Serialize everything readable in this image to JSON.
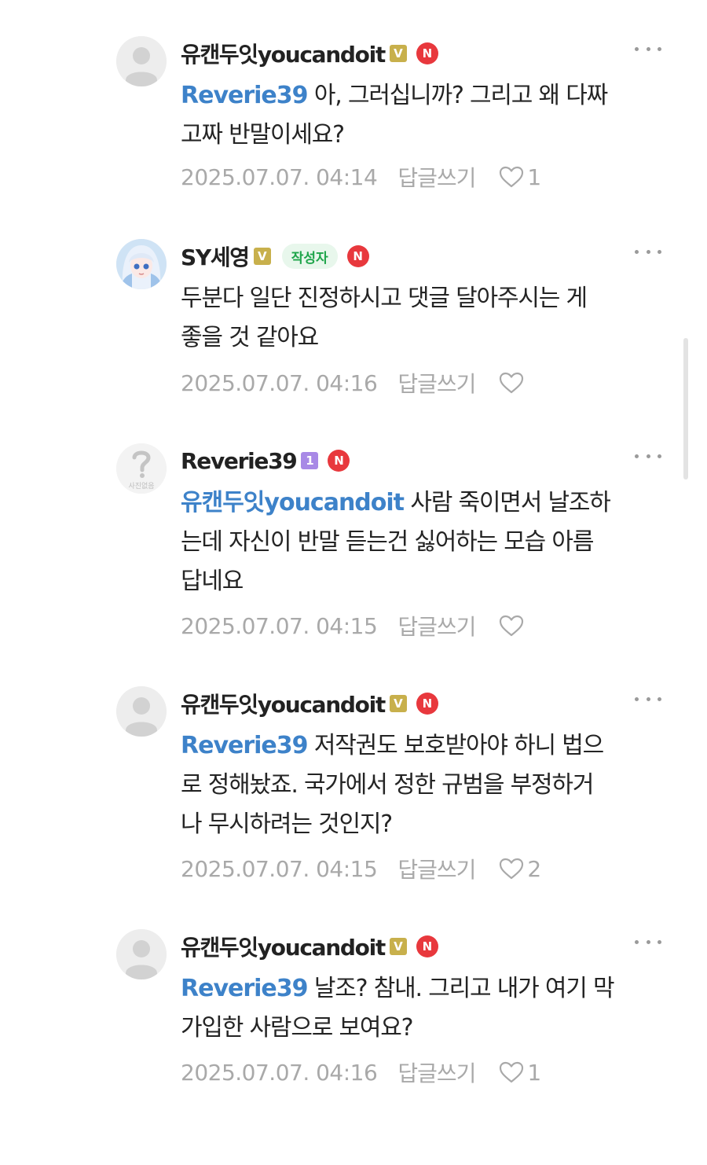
{
  "colors": {
    "mention": "#3d82c9",
    "meta": "#a9a9a9",
    "manager_badge": "#c8b04c",
    "member_badge": "#a889e6",
    "naver_badge": "#e8383d",
    "author_tag_text": "#1ea54a",
    "author_tag_bg": "#e8f7ec"
  },
  "labels": {
    "reply": "답글쓰기",
    "author_tag": "작성자",
    "naver_badge": "N"
  },
  "comments": [
    {
      "avatar": "default-profile",
      "nickname": "유캔두잇youcandoit",
      "level_badge": "V",
      "mention": "Reverie39",
      "lines": [
        "아, 그러십니까? 그리고 왜 다짜",
        "고짜 반말이세요?"
      ],
      "date": "2025.07.07. 04:14",
      "likes": "1"
    },
    {
      "avatar": "anime-character",
      "nickname": "SY세영",
      "level_badge": "V",
      "is_author": true,
      "mention": "",
      "lines": [
        "두분다 일단 진정하시고 댓글 달아주시는 게",
        "좋을 것 같아요"
      ],
      "date": "2025.07.07. 04:16",
      "likes": ""
    },
    {
      "avatar": "no-photo",
      "avatar_caption": "사진없음",
      "nickname": "Reverie39",
      "level_badge": "1",
      "mention": "유캔두잇youcandoit",
      "lines": [
        "사람 죽이면서 날조하",
        "는데 자신이 반말 듣는건 싫어하는 모습 아름",
        "답네요"
      ],
      "date": "2025.07.07. 04:15",
      "likes": ""
    },
    {
      "avatar": "default-profile",
      "nickname": "유캔두잇youcandoit",
      "level_badge": "V",
      "mention": "Reverie39",
      "lines": [
        "저작권도 보호받아야 하니 법으",
        "로 정해놨죠. 국가에서 정한 규범을 부정하거",
        "나 무시하려는 것인지?"
      ],
      "date": "2025.07.07. 04:15",
      "likes": "2"
    },
    {
      "avatar": "default-profile",
      "nickname": "유캔두잇youcandoit",
      "level_badge": "V",
      "mention": "Reverie39",
      "lines": [
        "날조? 참내. 그리고 내가 여기 막",
        "가입한 사람으로 보여요?"
      ],
      "date": "2025.07.07. 04:16",
      "likes": "1"
    }
  ]
}
